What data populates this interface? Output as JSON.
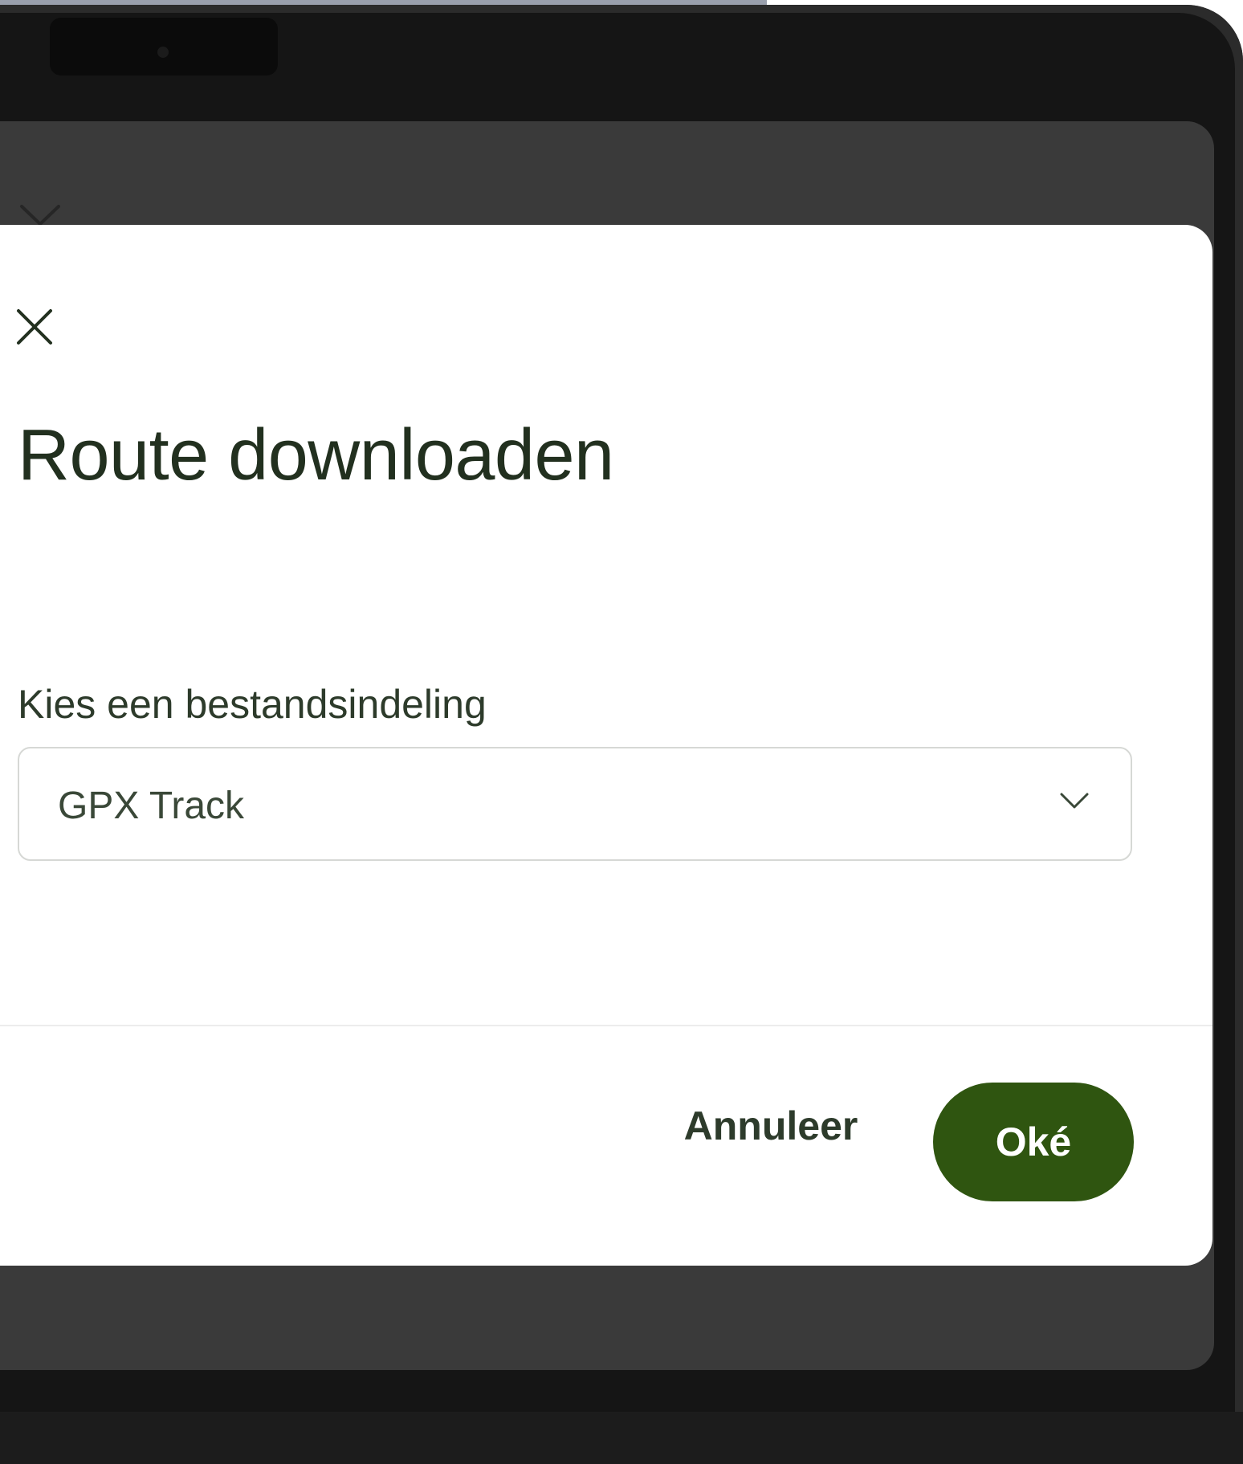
{
  "dialog": {
    "title": "Route downloaden",
    "field_label": "Kies een bestandsindeling",
    "format_select": {
      "selected": "GPX Track"
    },
    "buttons": {
      "cancel": "Annuleer",
      "ok": "Oké"
    }
  },
  "icons": {
    "close": "close-icon",
    "dropdown": "chevron-down-icon"
  },
  "colors": {
    "primary_button": "#2f5510",
    "title_text": "#22301f",
    "backdrop": "#3a3a3a",
    "device_frame": "#151515"
  }
}
